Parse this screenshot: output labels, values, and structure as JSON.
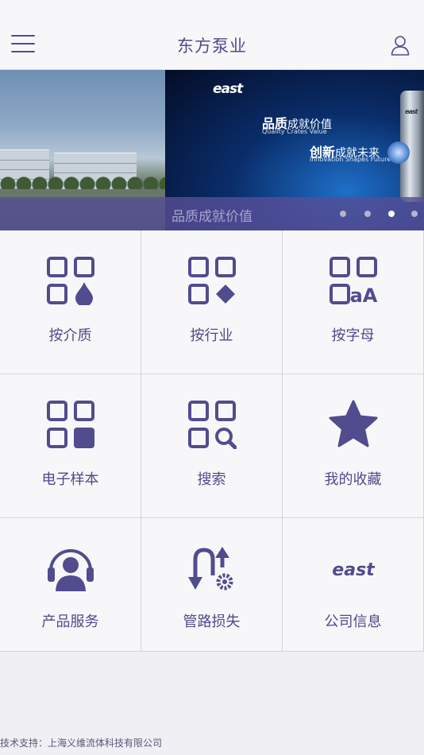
{
  "header": {
    "title": "东方泵业",
    "menu_icon": "hamburger-menu-icon",
    "user_icon": "user-profile-icon"
  },
  "banner": {
    "brand": "east",
    "slogan_primary_bold": "品质",
    "slogan_primary_rest": "成就价值",
    "slogan_primary_en": "Quality Crates Value",
    "slogan_secondary_bold": "创新",
    "slogan_secondary_rest": "成就未来",
    "slogan_secondary_en": "Innovation Shapes Future",
    "pump_brand": "east",
    "caption": "品质成就价值",
    "dots_total": 4,
    "active_dot": 3
  },
  "menu": {
    "items": [
      {
        "label": "按介质",
        "icon": "grid-droplet-icon"
      },
      {
        "label": "按行业",
        "icon": "grid-diamond-icon"
      },
      {
        "label": "按字母",
        "icon": "grid-letters-icon",
        "icon_text": "aA"
      },
      {
        "label": "电子样本",
        "icon": "grid-sample-icon"
      },
      {
        "label": "搜索",
        "icon": "grid-search-icon"
      },
      {
        "label": "我的收藏",
        "icon": "star-icon"
      },
      {
        "label": "产品服务",
        "icon": "headset-user-icon"
      },
      {
        "label": "管路损失",
        "icon": "pipe-loss-icon"
      },
      {
        "label": "公司信息",
        "icon": "east-logo-icon",
        "icon_text": "east"
      }
    ]
  },
  "footer": {
    "text": "技术支持：上海义维流体科技有限公司"
  },
  "colors": {
    "accent": "#514c8e",
    "background": "#efeff4",
    "caption_bar": "#564e96"
  }
}
